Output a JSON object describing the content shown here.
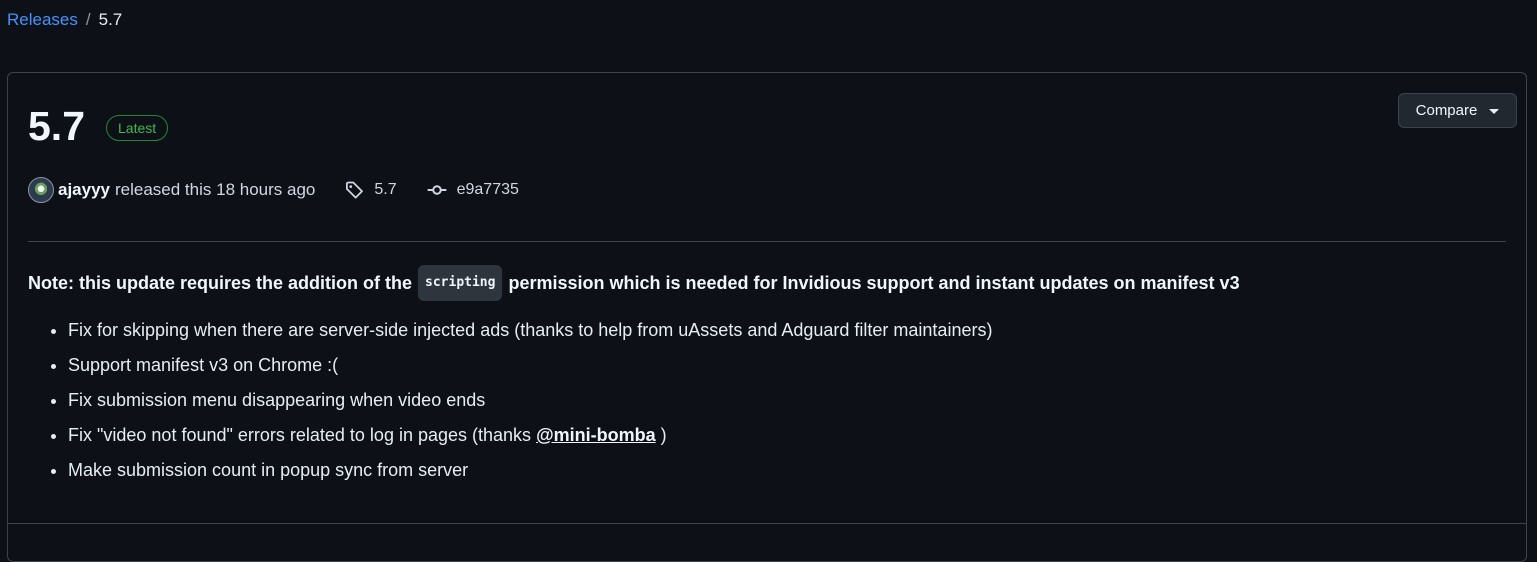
{
  "breadcrumb": {
    "parent": "Releases",
    "separator": "/",
    "current": "5.7"
  },
  "release": {
    "title": "5.7",
    "badge": "Latest",
    "compare_label": "Compare",
    "author": "ajayyy",
    "released_text": "released this 18 hours ago",
    "tag": "5.7",
    "commit": "e9a7735"
  },
  "notes": {
    "intro_before": "Note: this update requires the addition of the",
    "intro_code": "scripting",
    "intro_after": "permission which is needed for Invidious support and instant updates on manifest v3",
    "items": [
      "Fix for skipping when there are server-side injected ads (thanks to help from uAssets and Adguard filter maintainers)",
      "Support manifest v3 on Chrome :(",
      "Fix submission menu disappearing when video ends"
    ],
    "item4_before": "Fix \"video not found\" errors related to log in pages (thanks",
    "item4_mention": "@mini-bomba",
    "item4_after": ")",
    "item5": "Make submission count in popup sync from server"
  },
  "icons": {
    "tag": "tag-icon",
    "commit": "git-commit-icon",
    "caret": "triangle-down-icon"
  },
  "colors": {
    "link": "#4493f8",
    "latest_badge": "#3fb950",
    "background": "#0d1117"
  }
}
